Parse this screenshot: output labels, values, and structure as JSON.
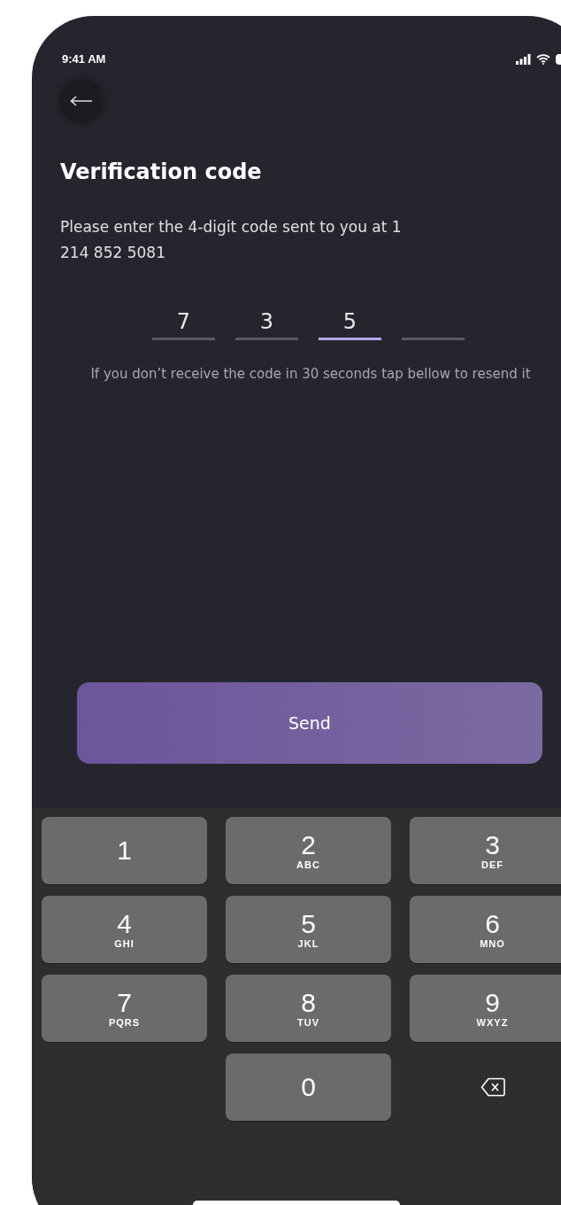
{
  "status_bar": {
    "time": "9:41 AM"
  },
  "title": "Verification code",
  "description": "Please enter the 4-digit code sent to you at 1 214 852 5081",
  "code_slots": [
    {
      "value": "7",
      "selected": false
    },
    {
      "value": "3",
      "selected": false
    },
    {
      "value": "5",
      "selected": true
    },
    {
      "selected": false
    }
  ],
  "hint": "If you don’t receive the code in 30 seconds tap bellow to resend it",
  "send_button": "Send",
  "keypad": [
    {
      "kind": "digit",
      "digit": "1"
    },
    {
      "kind": "digit",
      "digit": "2",
      "letters": "ABC"
    },
    {
      "kind": "digit",
      "digit": "3",
      "letters": "DEF"
    },
    {
      "kind": "digit",
      "digit": "4",
      "letters": "GHI"
    },
    {
      "kind": "digit",
      "digit": "5",
      "letters": "JKL"
    },
    {
      "kind": "digit",
      "digit": "6",
      "letters": "MNO"
    },
    {
      "kind": "digit",
      "digit": "7",
      "letters": "PQRS"
    },
    {
      "kind": "digit",
      "digit": "8",
      "letters": "TUV"
    },
    {
      "kind": "digit",
      "digit": "9",
      "letters": "WXYZ"
    },
    {
      "kind": "blank"
    },
    {
      "kind": "digit",
      "digit": "0"
    },
    {
      "kind": "backspace"
    }
  ]
}
